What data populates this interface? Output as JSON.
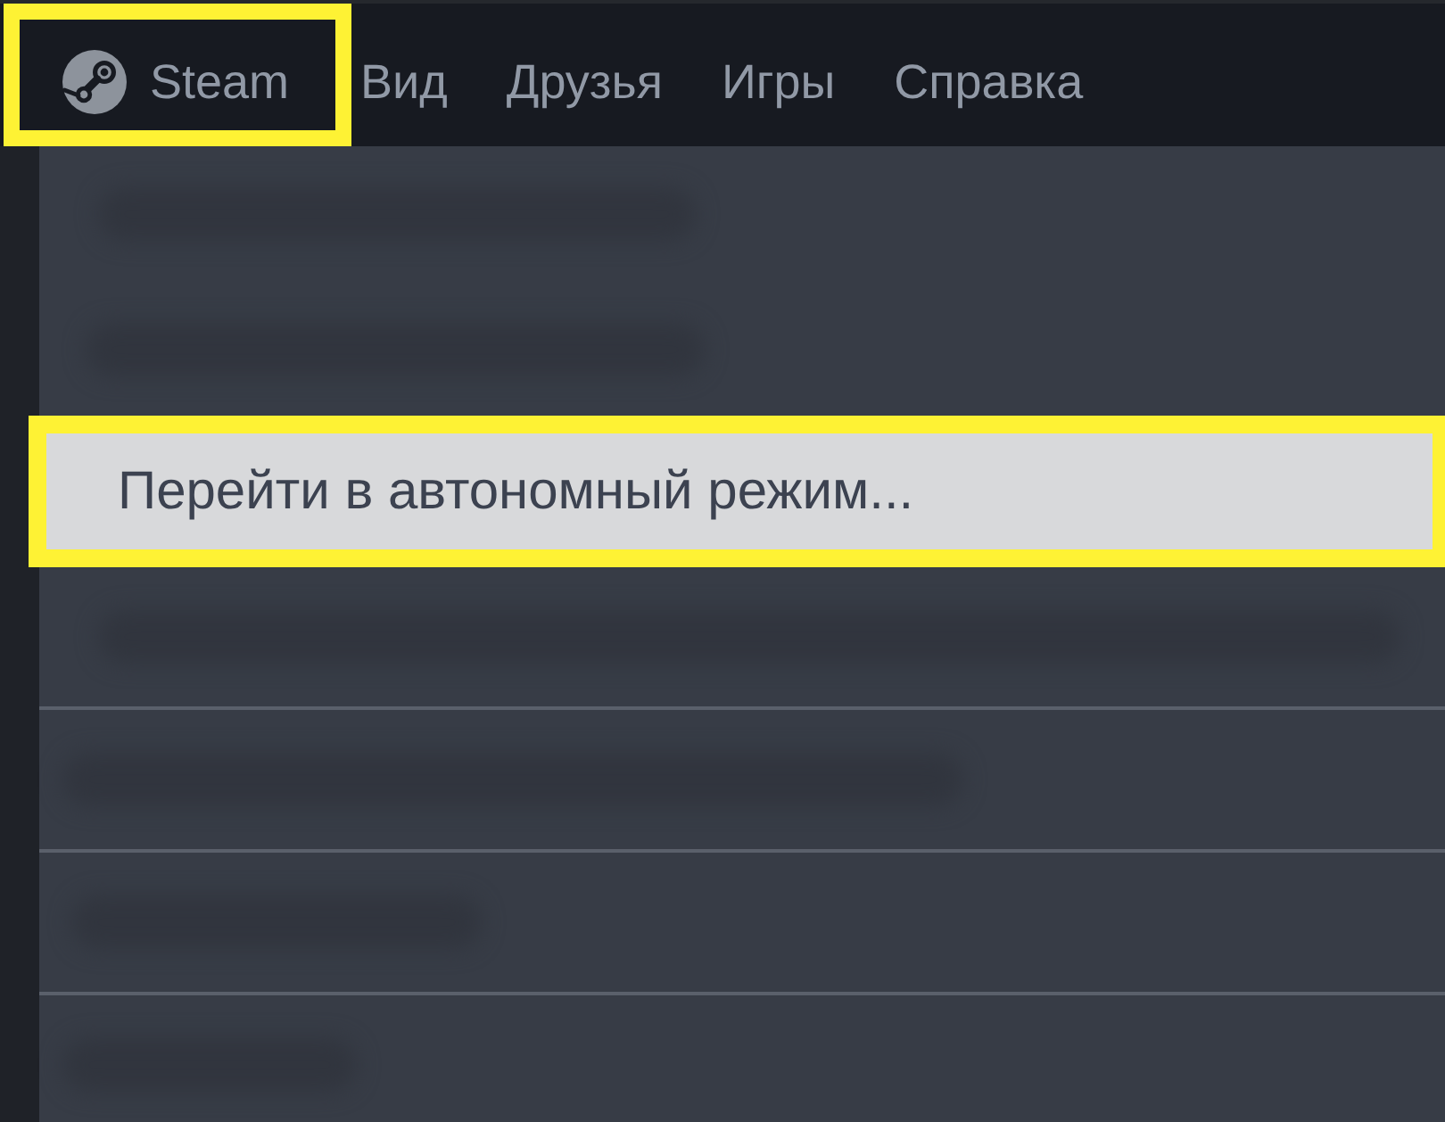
{
  "menubar": {
    "items": [
      {
        "kind": "app",
        "label": "Steam",
        "highlighted": true
      },
      {
        "kind": "menu",
        "label": "Вид",
        "highlighted": false
      },
      {
        "kind": "menu",
        "label": "Друзья",
        "highlighted": false
      },
      {
        "kind": "menu",
        "label": "Игры",
        "highlighted": false
      },
      {
        "kind": "menu",
        "label": "Справка",
        "highlighted": false
      }
    ]
  },
  "menu": {
    "items": [
      {
        "kind": "blurred",
        "selected": false,
        "highlighted": false
      },
      {
        "kind": "blurred",
        "selected": false,
        "highlighted": false
      },
      {
        "kind": "item",
        "label": "Перейти в автономный режим...",
        "selected": true,
        "highlighted": true
      },
      {
        "kind": "blurred",
        "selected": false,
        "highlighted": false
      },
      {
        "kind": "divider"
      },
      {
        "kind": "blurred",
        "selected": false,
        "highlighted": false
      },
      {
        "kind": "divider"
      },
      {
        "kind": "blurred",
        "selected": false,
        "highlighted": false
      },
      {
        "kind": "divider"
      },
      {
        "kind": "blurred",
        "selected": false,
        "highlighted": false
      }
    ]
  }
}
